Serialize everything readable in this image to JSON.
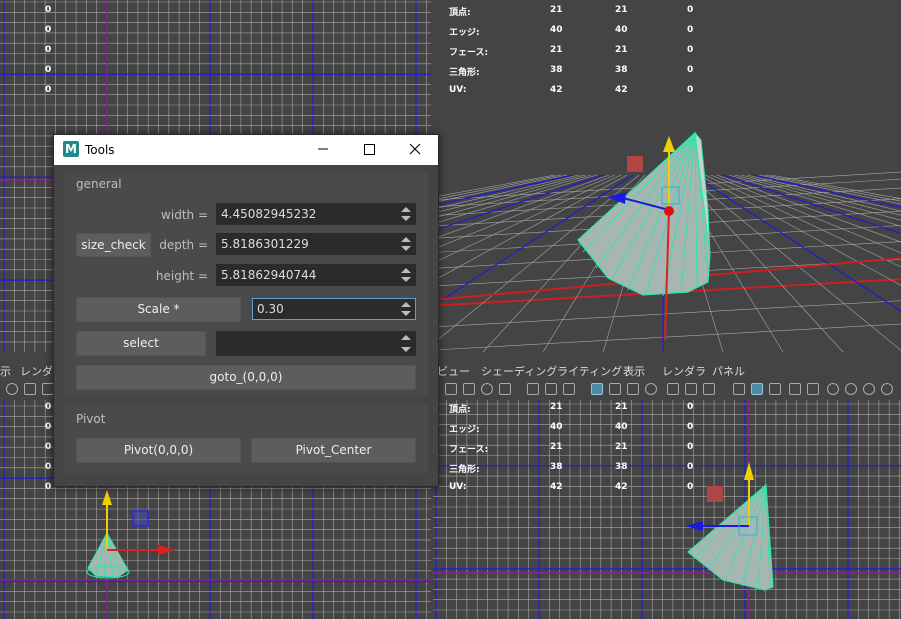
{
  "stats": {
    "rows": [
      {
        "label": "頂点:",
        "v1": "21",
        "v2": "21",
        "v3": "0"
      },
      {
        "label": "エッジ:",
        "v1": "40",
        "v2": "40",
        "v3": "0"
      },
      {
        "label": "フェース:",
        "v1": "21",
        "v2": "21",
        "v3": "0"
      },
      {
        "label": "三角形:",
        "v1": "38",
        "v2": "38",
        "v3": "0"
      },
      {
        "label": "UV:",
        "v1": "42",
        "v2": "42",
        "v3": "0"
      }
    ],
    "zeros": [
      "0",
      "0",
      "0",
      "0",
      "0"
    ]
  },
  "viewport_menu_right": [
    "ビュー",
    "シェーディング",
    "ライティング",
    "表示",
    "レンダラ",
    "パネル"
  ],
  "viewport_menu_left": [
    "示",
    "レンダラ"
  ],
  "colors": {
    "grid": "#a6a6a6",
    "axis_blue": "#1c1cd6",
    "axis_red": "#cc2020",
    "axis_magenta": "#9a1a9a",
    "cone_fill": "#9fb5b0",
    "cone_edge": "#2fe6a6",
    "dialog_bg": "#444444",
    "field_bg": "#2b2b2b"
  },
  "dialog": {
    "title": "Tools",
    "logo": "M",
    "general": {
      "title": "general",
      "size_check_label": "size_check",
      "width_label": "width =",
      "width_value": "4.45082945232",
      "depth_label": "depth =",
      "depth_value": "5.8186301229",
      "height_label": "height =",
      "height_value": "5.81862940744",
      "scale_label": "Scale *",
      "scale_value": "0.30",
      "select_label": "select",
      "select_value": "",
      "goto_label": "goto_(0,0,0)"
    },
    "pivot": {
      "title": "Pivot",
      "pivot_origin_label": "Pivot(0,0,0)",
      "pivot_center_label": "Pivot_Center"
    }
  }
}
